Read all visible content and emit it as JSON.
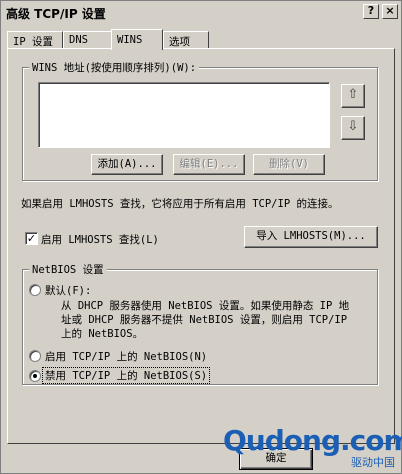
{
  "window": {
    "title": "高级 TCP/IP 设置",
    "help_label": "?",
    "close_label": "×"
  },
  "tabs": [
    {
      "label": "IP 设置"
    },
    {
      "label": "DNS"
    },
    {
      "label": "WINS"
    },
    {
      "label": "选项"
    }
  ],
  "wins": {
    "group_label": "WINS 地址(按使用顺序排列)(W):",
    "up_icon": "⇧",
    "down_icon": "⇩",
    "add_label": "添加(A)...",
    "edit_label": "编辑(E)...",
    "delete_label": "删除(V)"
  },
  "lmhosts": {
    "info": "如果启用 LMHOSTS 查找，它将应用于所有启用 TCP/IP 的连接。",
    "enable_label": "启用 LMHOSTS 查找(L)",
    "checked_mark": "✓",
    "import_label": "导入 LMHOSTS(M)..."
  },
  "netbios": {
    "group_label": "NetBIOS 设置",
    "default_label": "默认(F):",
    "default_desc_1": "从 DHCP 服务器使用 NetBIOS 设置。如果使用静态 IP 地",
    "default_desc_2": "址或 DHCP 服务器不提供 NetBIOS 设置，则启用 TCP/IP",
    "default_desc_3": "上的 NetBIOS。",
    "enable_label": "启用 TCP/IP 上的 NetBIOS(N)",
    "disable_label": "禁用 TCP/IP 上的 NetBIOS(S)",
    "selected": "disable"
  },
  "footer": {
    "ok_label": "确定"
  },
  "watermark": {
    "main": "Qudong.com",
    "sub": "驱动中国"
  }
}
